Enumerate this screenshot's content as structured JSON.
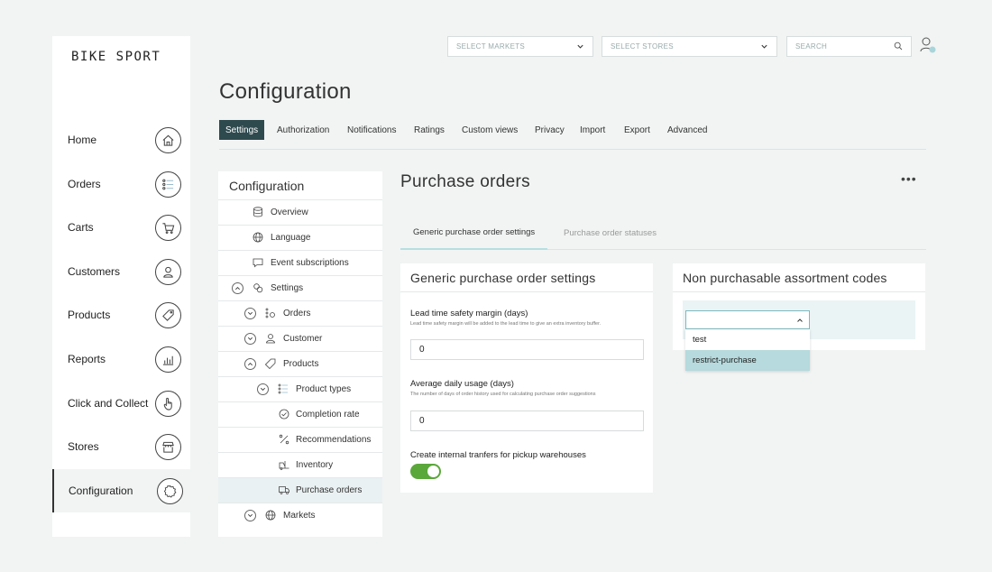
{
  "brand": {
    "logo": "BIKE SPORT"
  },
  "sidebar": {
    "items": [
      {
        "label": "Home",
        "icon": "home-icon"
      },
      {
        "label": "Orders",
        "icon": "list-icon"
      },
      {
        "label": "Carts",
        "icon": "cart-icon"
      },
      {
        "label": "Customers",
        "icon": "user-icon"
      },
      {
        "label": "Products",
        "icon": "tag-icon"
      },
      {
        "label": "Reports",
        "icon": "chart-icon"
      },
      {
        "label": "Click and Collect",
        "icon": "hand-pointer-icon"
      },
      {
        "label": "Stores",
        "icon": "store-icon"
      },
      {
        "label": "Configuration",
        "icon": "gear-icon",
        "active": true
      }
    ]
  },
  "topbar": {
    "markets_placeholder": "SELECT MARKETS",
    "stores_placeholder": "SELECT STORES",
    "search_placeholder": "SEARCH"
  },
  "page": {
    "title": "Configuration"
  },
  "tabs": [
    {
      "label": "Settings",
      "active": true
    },
    {
      "label": "Authorization"
    },
    {
      "label": "Notifications"
    },
    {
      "label": "Ratings"
    },
    {
      "label": "Custom views"
    },
    {
      "label": "Privacy"
    },
    {
      "label": "Import"
    },
    {
      "label": "Export"
    },
    {
      "label": "Advanced"
    }
  ],
  "tree": {
    "title": "Configuration",
    "items": [
      {
        "label": "Overview"
      },
      {
        "label": "Language"
      },
      {
        "label": "Event subscriptions"
      },
      {
        "label": "Settings"
      },
      {
        "label": "Orders"
      },
      {
        "label": "Customer"
      },
      {
        "label": "Products"
      },
      {
        "label": "Product types"
      },
      {
        "label": "Completion rate"
      },
      {
        "label": "Recommendations"
      },
      {
        "label": "Inventory"
      },
      {
        "label": "Purchase orders",
        "selected": true
      },
      {
        "label": "Markets"
      }
    ]
  },
  "purchase_orders": {
    "title": "Purchase orders",
    "more": "•••",
    "subtabs": [
      {
        "label": "Generic purchase order settings",
        "active": true
      },
      {
        "label": "Purchase order statuses"
      }
    ],
    "generic": {
      "title": "Generic purchase order settings",
      "lead_time": {
        "label": "Lead time safety margin (days)",
        "help": "Lead time safety margin will be added to the lead time to give an extra inventory buffer.",
        "value": "0"
      },
      "avg_usage": {
        "label": "Average daily usage (days)",
        "help": "The number of days of order history used for calculating purchase order suggestions",
        "value": "0"
      },
      "internal_transfers": {
        "label": "Create internal tranfers for pickup warehouses",
        "enabled": true
      }
    },
    "non_purchasable": {
      "title": "Non purchasable assortment codes",
      "select_value": "",
      "options": [
        "test",
        "restrict-purchase"
      ],
      "highlighted": "restrict-purchase"
    }
  }
}
